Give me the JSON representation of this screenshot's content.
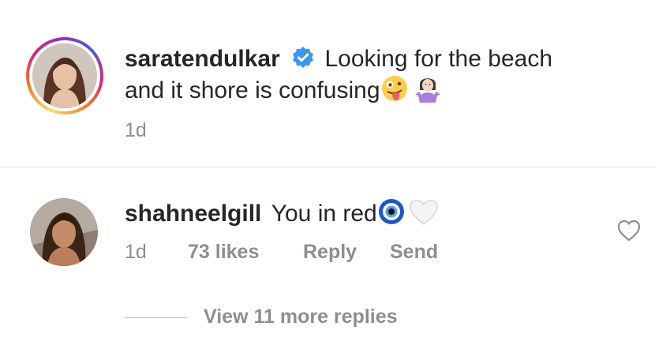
{
  "caption": {
    "username": "saratendulkar",
    "verified_icon": "verified-badge-icon",
    "text_line1": "Looking for the beach",
    "text_line2": "and it shore is confusing",
    "emojis": [
      "zany-face-emoji",
      "shrug-emoji"
    ],
    "time": "1d"
  },
  "comment": {
    "username": "shahneelgill",
    "text": "You in red",
    "emojis": [
      "nazar-amulet-emoji",
      "white-heart-emoji"
    ],
    "time": "1d",
    "likes": "73 likes",
    "reply_label": "Reply",
    "send_label": "Send",
    "like_icon": "heart-outline-icon"
  },
  "view_more_replies": "View 11 more replies",
  "colors": {
    "text": "#262626",
    "secondary": "#8e8e8e",
    "verified": "#3897f0",
    "divider": "#dbdbdb"
  }
}
